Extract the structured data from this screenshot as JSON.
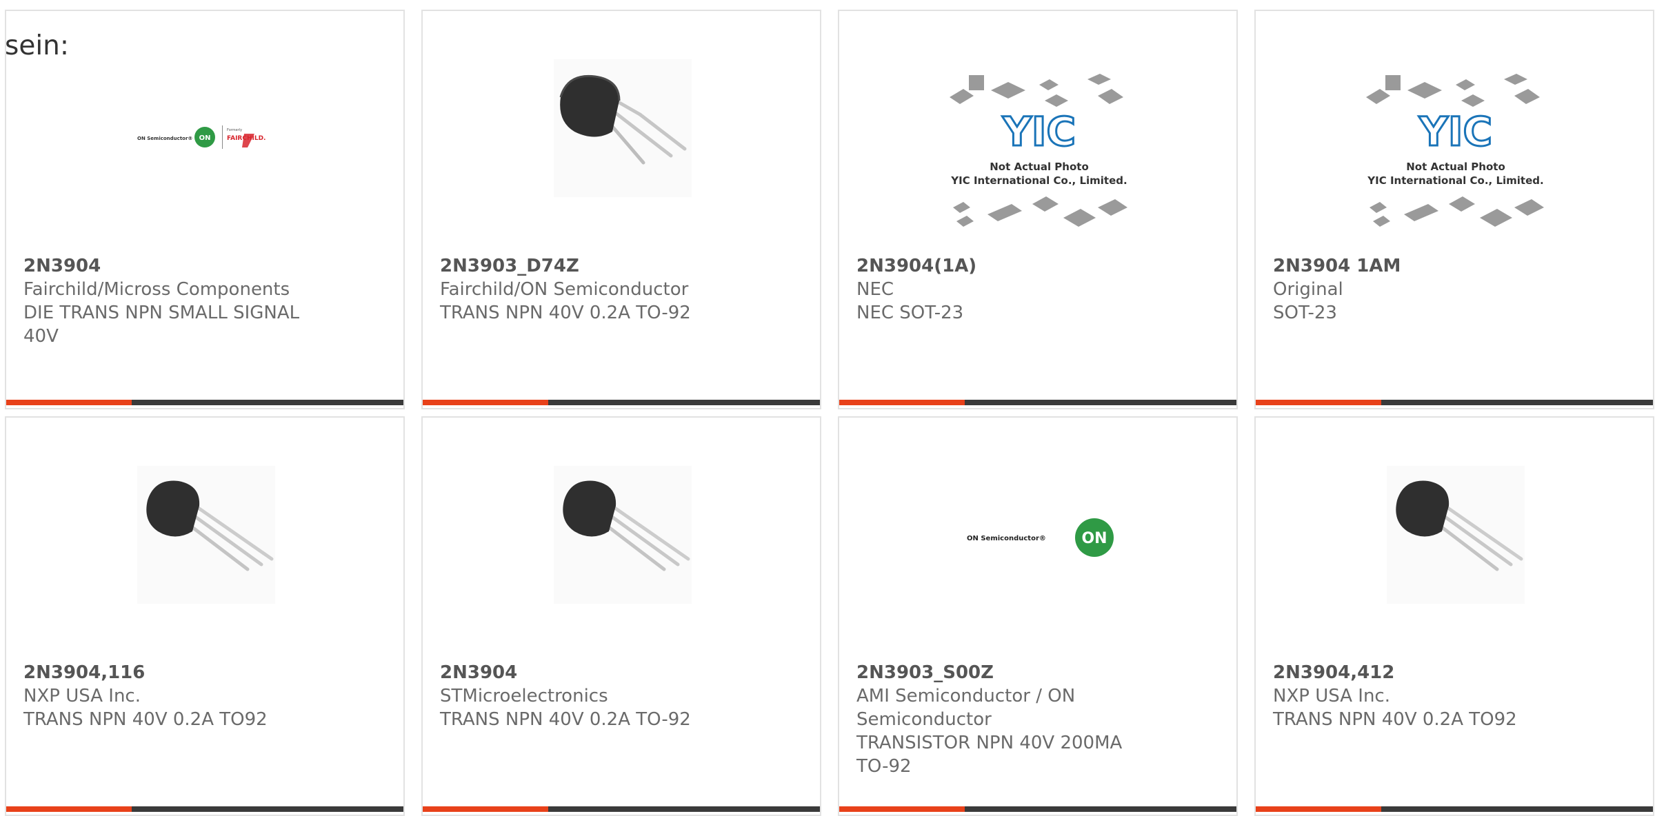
{
  "intro": "sein:",
  "colors": {
    "accent": "#e8411a",
    "bar_dark": "#3a3a3a",
    "text": "#6a6a6a"
  },
  "products": [
    {
      "part": "2N3904",
      "manufacturer": "Fairchild/Micross Components",
      "description": "DIE TRANS NPN SMALL SIGNAL 40V",
      "image": "on-fairchild-logo"
    },
    {
      "part": "2N3903_D74Z",
      "manufacturer": "Fairchild/ON Semiconductor",
      "description": "TRANS NPN 40V 0.2A TO-92",
      "image": "to92-transistor-bent-leads"
    },
    {
      "part": "2N3904(1A)",
      "manufacturer": "NEC",
      "description": "NEC SOT-23",
      "image": "yic-placeholder",
      "placeholder_text": [
        "Not Actual Photo",
        "YIC International Co., Limited."
      ]
    },
    {
      "part": "2N3904 1AM",
      "manufacturer": "Original",
      "description": "SOT-23",
      "image": "yic-placeholder",
      "placeholder_text": [
        "Not Actual Photo",
        "YIC International Co., Limited."
      ]
    },
    {
      "part": "2N3904,116",
      "manufacturer": "NXP USA Inc.",
      "description": "TRANS NPN 40V 0.2A TO92",
      "image": "to92-transistor"
    },
    {
      "part": "2N3904",
      "manufacturer": "STMicroelectronics",
      "description": "TRANS NPN 40V 0.2A TO-92",
      "image": "to92-transistor"
    },
    {
      "part": "2N3903_S00Z",
      "manufacturer": "AMI Semiconductor / ON Semiconductor",
      "description": "TRANSISTOR NPN 40V 200MA TO-92",
      "image": "on-semiconductor-logo"
    },
    {
      "part": "2N3904,412",
      "manufacturer": "NXP USA Inc.",
      "description": "TRANS NPN 40V 0.2A TO92",
      "image": "to92-transistor"
    }
  ],
  "logos": {
    "on_text": "ON Semiconductor®",
    "on_badge": "ON",
    "formerly": "Formerly",
    "fairchild": "FAIRCHILD.",
    "yic": "YIC"
  }
}
